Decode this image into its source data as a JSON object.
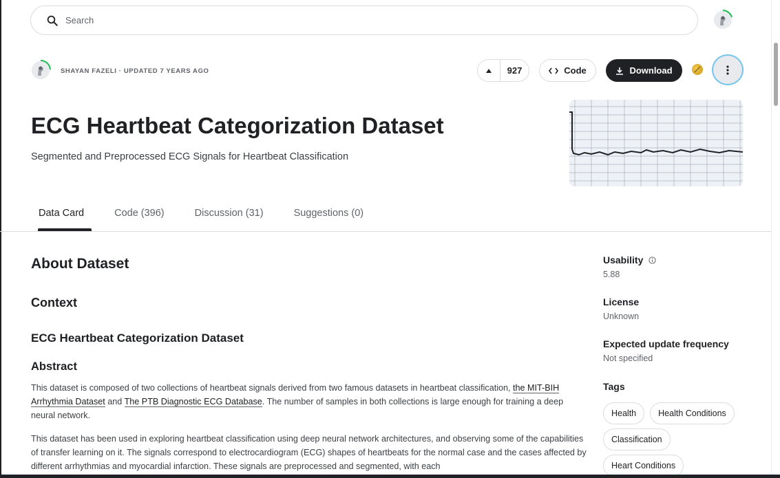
{
  "search": {
    "placeholder": "Search"
  },
  "header": {
    "owner": "SHAYAN FAZELI",
    "updated": "UPDATED 7 YEARS AGO",
    "vote_count": "927",
    "code_label": "Code",
    "download_label": "Download"
  },
  "dataset": {
    "title": "ECG Heartbeat Categorization Dataset",
    "subtitle": "Segmented and Preprocessed ECG Signals for Heartbeat Classification"
  },
  "tabs": [
    {
      "label": "Data Card"
    },
    {
      "label": "Code (396)"
    },
    {
      "label": "Discussion (31)"
    },
    {
      "label": "Suggestions (0)"
    }
  ],
  "content": {
    "about": "About Dataset",
    "context": "Context",
    "dataset_heading": "ECG Heartbeat Categorization Dataset",
    "abstract": "Abstract",
    "p1_a": "This dataset is composed of two collections of heartbeat signals derived from two famous datasets in heartbeat classification, ",
    "p1_link1": "the MIT-BIH Arrhythmia Dataset",
    "p1_b": " and ",
    "p1_link2": "The PTB Diagnostic ECG Database",
    "p1_c": ". The number of samples in both collections is large enough for training a deep neural network.",
    "p2": "This dataset has been used in exploring heartbeat classification using deep neural network architectures, and observing some of the capabilities of transfer learning on it. The signals correspond to electrocardiogram (ECG) shapes of heartbeats for the normal case and the cases affected by different arrhythmias and myocardial infarction. These signals are preprocessed and segmented, with each"
  },
  "sidebar": {
    "usability_label": "Usability",
    "usability_value": "5.88",
    "license_label": "License",
    "license_value": "Unknown",
    "frequency_label": "Expected update frequency",
    "frequency_value": "Not specified",
    "tags_label": "Tags",
    "tags": [
      "Health",
      "Health Conditions",
      "Classification",
      "Heart Conditions"
    ]
  },
  "colors": {
    "primary": "#202124",
    "accent_ring": "#74c6ec",
    "progress": "#20be52"
  },
  "icons": {
    "search": "search-icon",
    "upvote": "arrow-up-icon",
    "code": "code-icon",
    "download": "download-icon",
    "more": "more-vertical-icon",
    "info": "info-icon",
    "medal": "medal-icon"
  }
}
